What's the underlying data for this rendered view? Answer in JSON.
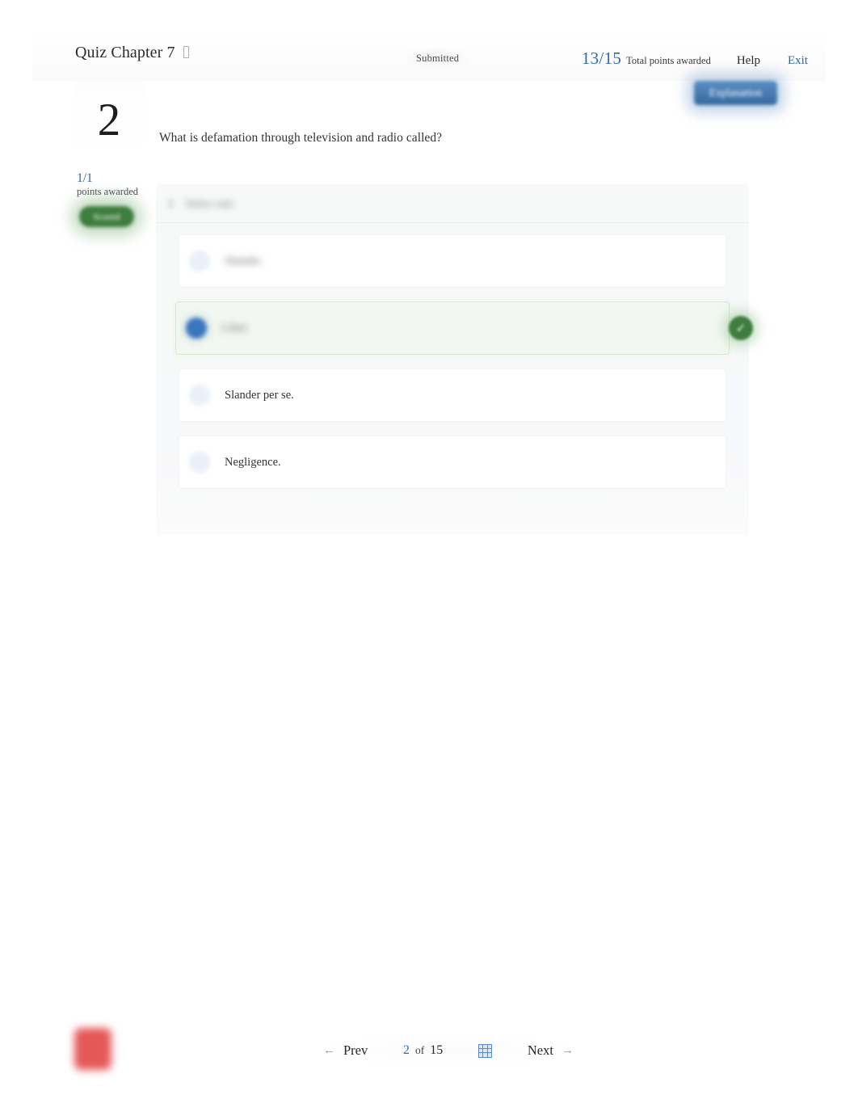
{
  "header": {
    "title": "Quiz Chapter 7",
    "title_icon": "info-glyph-icon",
    "status_badge": "Submitted",
    "score": "13/15",
    "score_label": "Total points awarded",
    "help_label": "Help",
    "exit_label": "Exit"
  },
  "explanation": {
    "label": "Explanation"
  },
  "question": {
    "number": "2",
    "text": "What is defamation through television and radio called?",
    "points_awarded": "1/1",
    "points_label": "points awarded",
    "status_badge": "Scored"
  },
  "answer_panel": {
    "head_label": "Select one:",
    "options": [
      {
        "label": "Slander.",
        "selected": false,
        "correct": false,
        "blurred": true
      },
      {
        "label": "Libel.",
        "selected": true,
        "correct": true,
        "blurred": true
      },
      {
        "label": "Slander per se.",
        "selected": false,
        "correct": false,
        "blurred": false
      },
      {
        "label": "Negligence.",
        "selected": false,
        "correct": false,
        "blurred": false
      }
    ],
    "correct_mark": "✓"
  },
  "bottom_nav": {
    "prev_arrow": "←",
    "prev_label": "Prev",
    "current_page": "2",
    "of_label": "of",
    "total_pages": "15",
    "grid_icon": "grid-view-icon",
    "next_label": "Next",
    "next_arrow": "→"
  },
  "colors": {
    "accent_blue": "#2e69a8",
    "correct_green": "#3d7d3d",
    "correct_row_bg": "#f2f8f1",
    "selected_radio": "#3b76bd",
    "indicator_red": "#e03b3b",
    "panel_bg": "#f7f8f9"
  }
}
